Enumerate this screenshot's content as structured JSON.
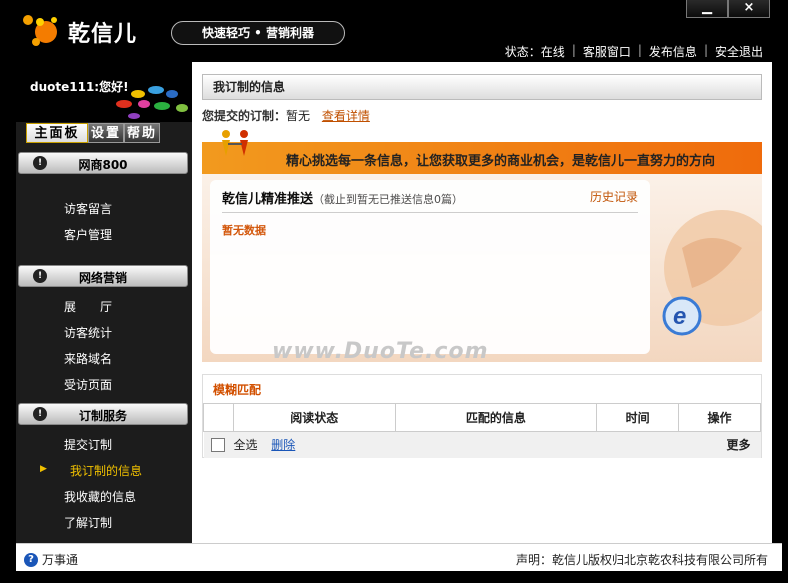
{
  "app": {
    "brand": "乾信儿",
    "slogan": "快速轻巧 • 营销利器"
  },
  "window": {
    "minimize": "▁",
    "close": "×"
  },
  "topbar": {
    "status": "状态：在线",
    "service": "客服窗口",
    "publish": "发布信息",
    "logout": "安全退出"
  },
  "sidebar": {
    "username": "duote111:您好!",
    "tabs": [
      "主面板",
      "设置",
      "帮助"
    ],
    "sections": [
      {
        "title": "网商800",
        "items": [
          "访客留言",
          "客户管理"
        ]
      },
      {
        "title": "网络营销",
        "items": [
          "展　　厅",
          "访客统计",
          "来路域名",
          "受访页面"
        ]
      },
      {
        "title": "订制服务",
        "items": [
          "提交订制",
          "我订制的信息",
          "我收藏的信息",
          "了解订制"
        ]
      }
    ]
  },
  "main": {
    "title": "我订制的信息",
    "submitted_label": "您提交的订制：",
    "submitted_value": "暂无",
    "view_detail": "查看详情",
    "banner_text": "精心挑选每一条信息，让您获取更多的商业机会，是乾信儿一直努力的方向",
    "push_title": "乾信儿精准推送",
    "push_note": "（截止到暂无已推送信息0篇）",
    "history": "历史记录",
    "no_data": "暂无数据",
    "watermark": "www.DuoTe.com",
    "fuzzy_title": "模糊匹配",
    "table_headers": [
      "",
      "阅读状态",
      "匹配的信息",
      "时间",
      "操作"
    ],
    "select_all": "全选",
    "delete": "删除",
    "more": "更多"
  },
  "footer": {
    "help": "万事通",
    "copyright": "声明：乾信儿版权归北京乾农科技有限公司所有"
  }
}
